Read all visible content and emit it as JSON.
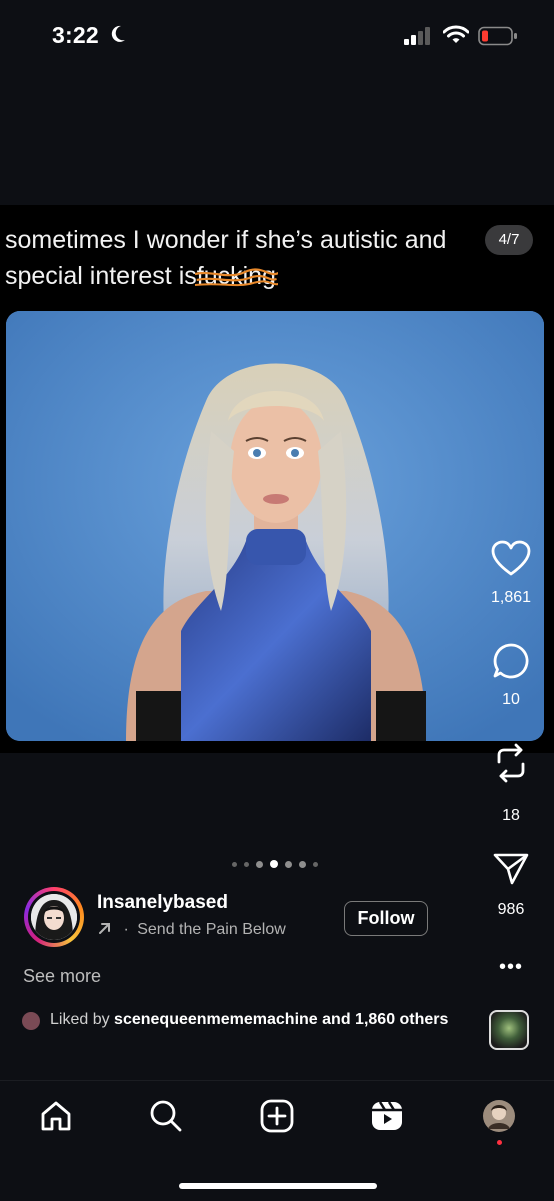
{
  "status_bar": {
    "time": "3:22",
    "icons": [
      "moon-icon",
      "cellular-signal-icon",
      "wifi-icon",
      "battery-low-icon"
    ],
    "battery_color": "#ff3b30"
  },
  "post": {
    "caption_before": "sometimes I wonder if she’s autistic and",
    "caption_line2_before": "special interest is",
    "caption_struck_word": "fucking",
    "scribble_color": "#e8892b",
    "slide_counter": "4/7",
    "image_description_icon": "photo",
    "pagination": {
      "total_dots": 7,
      "active_index": 3
    }
  },
  "actions": {
    "like_count": "1,861",
    "comment_count": "10",
    "repost_count": "18",
    "share_count": "986",
    "more_label": "•••"
  },
  "author": {
    "username": "Insanelybased",
    "audio_label": "Send the Pain Below",
    "follow_label": "Follow"
  },
  "see_more": "See more",
  "liked_by": {
    "prefix": "Liked by",
    "user": "scenequeenmememachine",
    "suffix": "and 1,860 others"
  },
  "bottom_nav": {
    "items": [
      "home-icon",
      "search-icon",
      "create-icon",
      "reels-icon",
      "profile-avatar"
    ]
  },
  "colors": {
    "background": "#0d0f14",
    "photo_blue": "#4f86c6",
    "notification_red": "#ff3040"
  }
}
